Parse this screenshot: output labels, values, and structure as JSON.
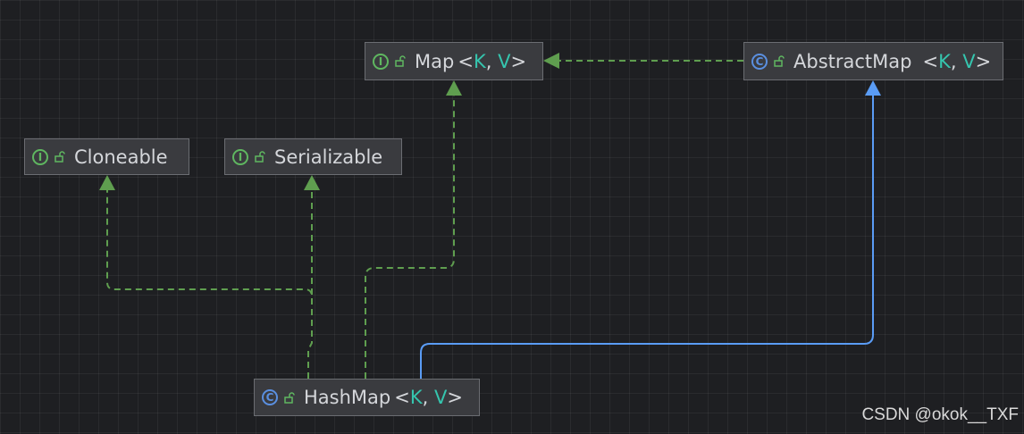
{
  "colors": {
    "background": "#1e1f22",
    "node_fill": "#3a3b3f",
    "node_border": "#6b6d72",
    "implements_edge": "#5f9e4f",
    "extends_edge": "#5a9cf5",
    "interface_badge": "#5fb760",
    "class_badge": "#5a8fe0",
    "type_param": "#35c5ae"
  },
  "nodes": {
    "map": {
      "kind": "interface",
      "badge": "I",
      "name": "Map",
      "params": [
        "K",
        "V"
      ]
    },
    "abstract_map": {
      "kind": "class",
      "badge": "C",
      "name": "AbstractMap",
      "params": [
        "K",
        "V"
      ]
    },
    "cloneable": {
      "kind": "interface",
      "badge": "I",
      "name": "Cloneable",
      "params": []
    },
    "serializable": {
      "kind": "interface",
      "badge": "I",
      "name": "Serializable",
      "params": []
    },
    "hash_map": {
      "kind": "class",
      "badge": "C",
      "name": "HashMap",
      "params": [
        "K",
        "V"
      ]
    }
  },
  "edges": [
    {
      "from": "abstract_map",
      "to": "map",
      "style": "dashed",
      "relation": "implements"
    },
    {
      "from": "hash_map",
      "to": "cloneable",
      "style": "dashed",
      "relation": "implements"
    },
    {
      "from": "hash_map",
      "to": "serializable",
      "style": "dashed",
      "relation": "implements"
    },
    {
      "from": "hash_map",
      "to": "map",
      "style": "dashed",
      "relation": "implements"
    },
    {
      "from": "hash_map",
      "to": "abstract_map",
      "style": "solid",
      "relation": "extends"
    }
  ],
  "watermark": "CSDN @okok__TXF"
}
